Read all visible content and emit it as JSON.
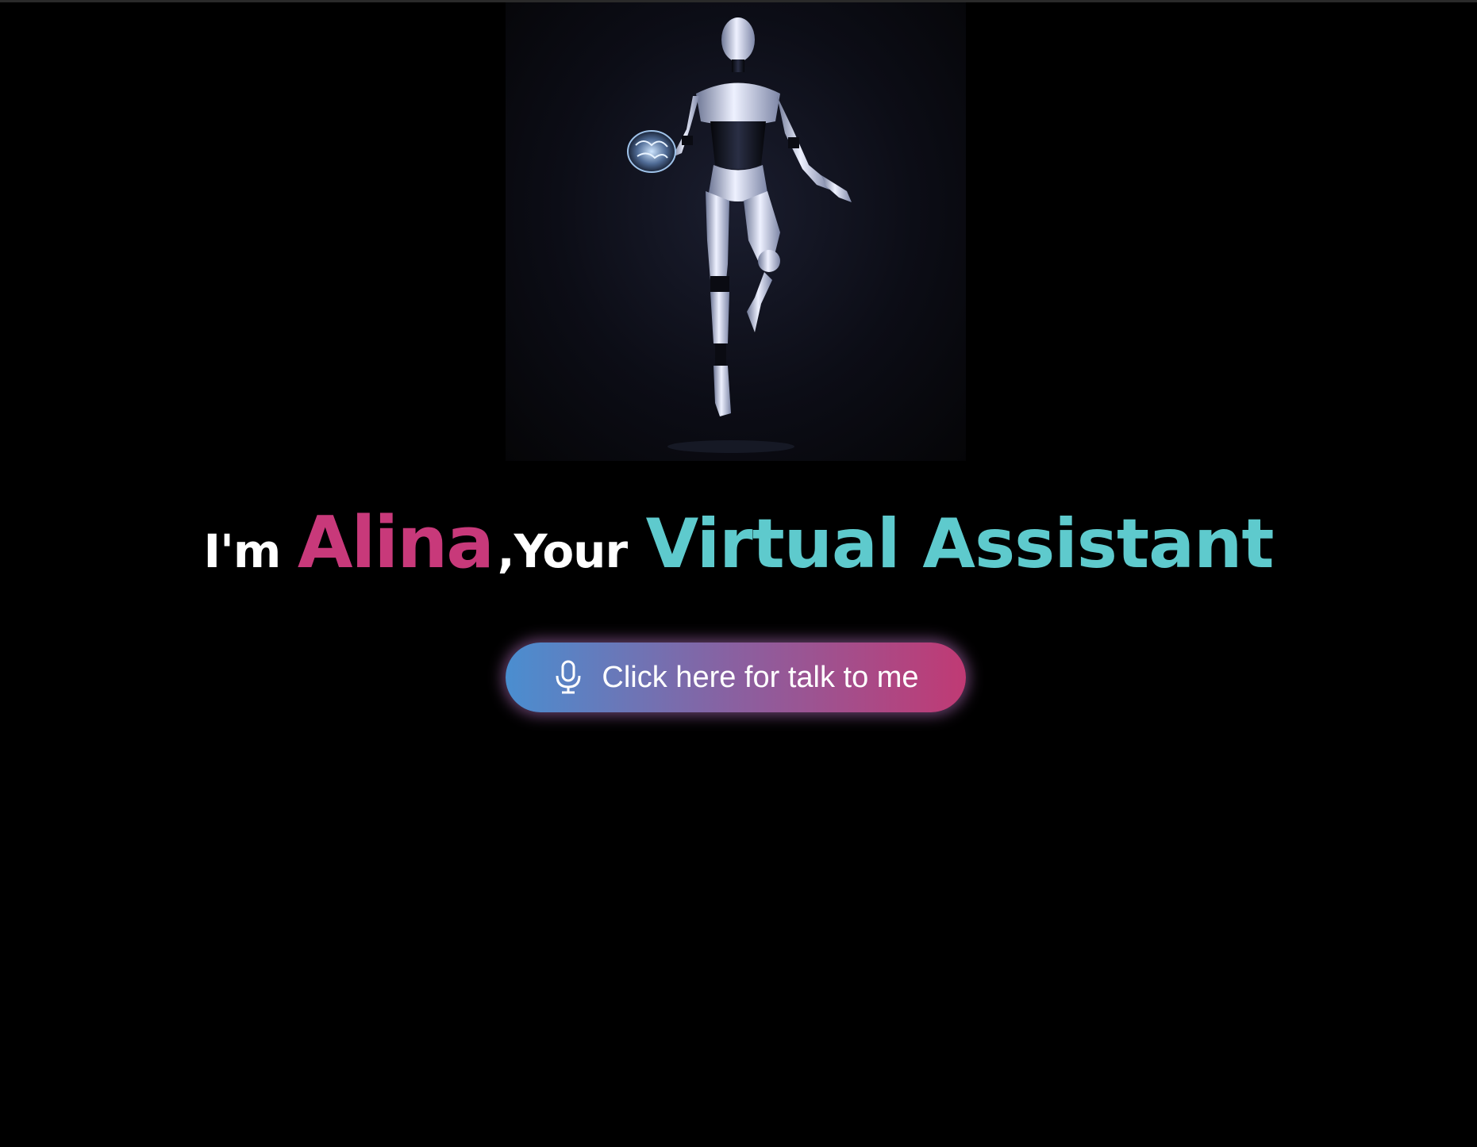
{
  "hero": {
    "image_alt": "Humanoid robot holding a glowing brain"
  },
  "headline": {
    "prefix": "I'm",
    "name": "Alina",
    "separator": ",Your",
    "role": "Virtual Assistant"
  },
  "talk_button": {
    "icon": "microphone-icon",
    "label": "Click here for talk to me"
  },
  "colors": {
    "background": "#000000",
    "name_accent": "#c8397a",
    "role_accent": "#5ecacd",
    "button_gradient_start": "#4a8ed0",
    "button_gradient_end": "#c03a74"
  }
}
